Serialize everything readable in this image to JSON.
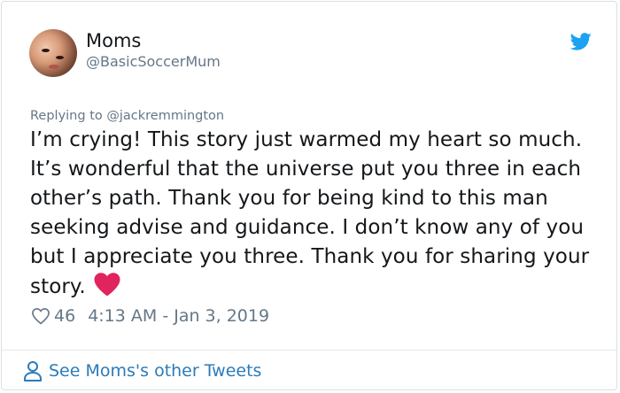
{
  "tweet": {
    "display_name": "Moms",
    "handle": "@BasicSoccerMum",
    "replying_to": "Replying to @jackremmington",
    "text": "I’m crying! This story just warmed my heart so much. It’s wonderful that the universe put you three in each other’s path. Thank you for being kind to this man seeking advise and guidance. I don’t know any of you but I appreciate you three. Thank you for sharing your story.",
    "emoji_icon": "red-heart-icon",
    "like_count": "46",
    "timestamp": "4:13 AM - Jan 3, 2019"
  },
  "footer": {
    "link_text": "See Moms's other Tweets",
    "icon": "person-icon"
  },
  "colors": {
    "text_primary": "#14171a",
    "text_secondary": "#657786",
    "twitter_blue": "#1da1f2",
    "link_blue": "#2b7bb9",
    "heart_red": "#e0245e"
  }
}
